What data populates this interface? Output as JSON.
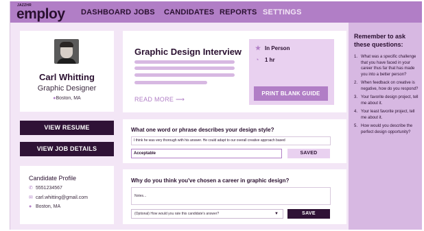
{
  "brand": {
    "small": "JAZZHR",
    "main": "employ"
  },
  "nav": {
    "items": [
      {
        "label": "DASHBOARD",
        "active": false
      },
      {
        "label": "JOBS",
        "active": false
      },
      {
        "label": "CANDIDATES",
        "active": false
      },
      {
        "label": "REPORTS",
        "active": false
      },
      {
        "label": "SETTINGS",
        "active": true
      }
    ]
  },
  "candidate": {
    "name": "Carl Whitting",
    "title": "Graphic Designer",
    "location": "Boston, MA"
  },
  "actions": {
    "view_resume": "VIEW RESUME",
    "view_job_details": "VIEW JOB DETAILS"
  },
  "contact": {
    "title": "Candidate Profile",
    "phone": "5551234567",
    "email": "carl.whitting@gmail.com",
    "location": "Boston, MA"
  },
  "interview": {
    "title": "Graphic Design Interview",
    "read_more": "READ MORE ⟶",
    "format": "In Person",
    "duration": "1 hr",
    "print_button": "PRINT BLANK GUIDE"
  },
  "question1": {
    "label": "What one word or phrase describes your design style?",
    "answer": "I think he was very thorough with his answer. He could adapt to our overall creative approach based",
    "rating": "Acceptable",
    "status_button": "SAVED"
  },
  "question2": {
    "label": "Why do you think you've chosen a career in graphic design?",
    "notes_placeholder": "Notes...",
    "rating_placeholder": "(Optional) How would you rate this candidate's answer?",
    "save_button": "SAVE"
  },
  "sidebar": {
    "title": "Remember to ask these questions:",
    "questions": [
      {
        "num": "1.",
        "text": "What was a specific challenge that you have faced in your career thus far that has made you into a better person?"
      },
      {
        "num": "2.",
        "text": "When feedback on creative is negative, how do you respond?"
      },
      {
        "num": "3.",
        "text": "Your favorite design project, tell me about it."
      },
      {
        "num": "4.",
        "text": "Your least favorite project, tell me about it."
      },
      {
        "num": "5.",
        "text": "How would you describe the perfect design opportunity?"
      }
    ]
  },
  "colors": {
    "nav_bg": "#b17ec6",
    "dark": "#2f1236",
    "accent": "#b17ec6",
    "page_bg": "#f3e6f6",
    "panel": "#d7b8e2"
  }
}
